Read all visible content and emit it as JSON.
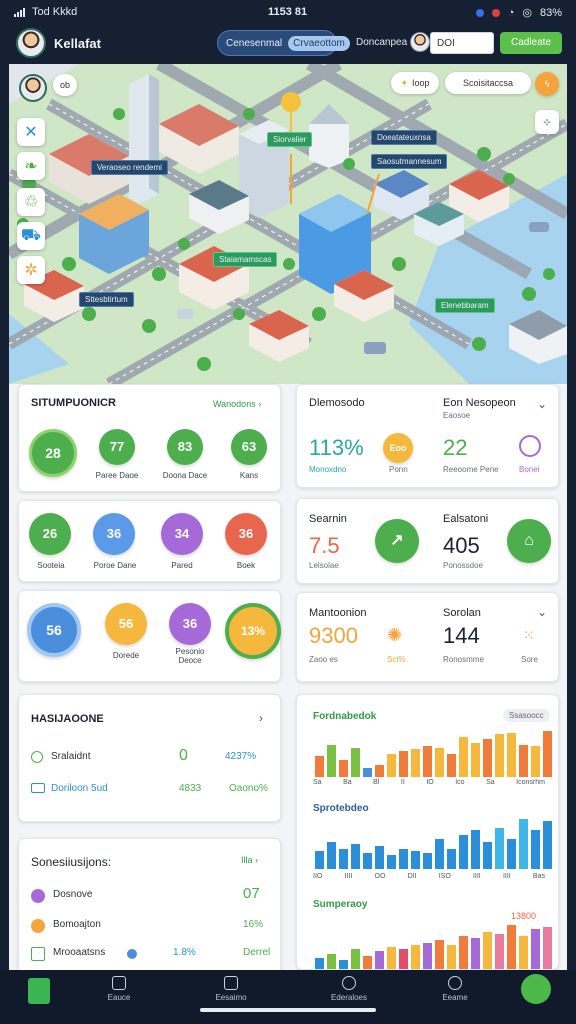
{
  "status_bar": {
    "carrier": "Tod Kkkd ",
    "time": "1153 81",
    "battery": "83%"
  },
  "header": {
    "title": "Kellafat",
    "segment": {
      "left": "Cenesenmal",
      "right": "Crvaeottom"
    },
    "profile_label": "Doncanpea",
    "search_value": "DOI",
    "action_label": "Cadleate"
  },
  "map": {
    "pill_left": "ob",
    "pill_mid": "Ioop",
    "pill_right": "Scoisitaccsa",
    "labels": {
      "label1": "Veraoseo rendemi",
      "label2": "Siorvalier",
      "label3": "Doeatateuxnsa",
      "label4": "Saosutmannesum",
      "label5": "Staiamamscas",
      "label6": "Sttesbtirtum",
      "label7": "Elenebbaram"
    }
  },
  "card1": {
    "title": "SITUMPUONICR",
    "link": "Wanodons",
    "items": [
      {
        "value": "28",
        "label": ""
      },
      {
        "value": "77",
        "label": "Paree Daoe"
      },
      {
        "value": "83",
        "label": "Doona Dace"
      },
      {
        "value": "63",
        "label": "Kans"
      }
    ]
  },
  "card2": {
    "items": [
      {
        "value": "26",
        "label": "Sooteia"
      },
      {
        "value": "36",
        "label": "Poroe Dane"
      },
      {
        "value": "34",
        "label": "Pared"
      },
      {
        "value": "36",
        "label": "Boek"
      }
    ]
  },
  "card3": {
    "items": [
      {
        "value": "56",
        "label": ""
      },
      {
        "value": "56",
        "label": "Dorede"
      },
      {
        "value": "36",
        "label": "Pesonio Deoce"
      },
      {
        "value": "13%",
        "label": ""
      }
    ]
  },
  "card4": {
    "title": "HASIJAOONE",
    "rows": [
      {
        "label": "Sralaidnt",
        "value": "0",
        "pct": "4237%"
      },
      {
        "label": "Doriloon 5ud",
        "value": "4833",
        "pct": "Oaono%"
      }
    ]
  },
  "card5": {
    "title": "Sonesiiusijons:",
    "link": "Illa",
    "rows": [
      {
        "label": "Dosnove",
        "value": "07"
      },
      {
        "label": "Bomoajton",
        "value": "16%"
      },
      {
        "label": "Mrooaatsns",
        "value": "1.8%",
        "extra": "Derrel"
      }
    ]
  },
  "kpi1": {
    "left_title": "Dlemosodo",
    "left_value": "113%",
    "left_sub": "Monoxdno",
    "right_title": "Eon Nesopeon",
    "right_sub": "Eaosoe",
    "right_value": "22",
    "right_value_sub": "Reeoome Pene",
    "mid_circle": "Eoo",
    "mid_sub": "Ponn",
    "icon_sub": "Bonei"
  },
  "kpi2": {
    "left_title": "Searnin",
    "left_value": "7.5",
    "left_sub": "Lelsolae",
    "right_title": "Ealsatoni",
    "right_value": "405",
    "right_sub": "Ponossdoe"
  },
  "kpi3": {
    "left_title": "Mantoonion",
    "left_value": "9300",
    "left_sub": "Zaoo es",
    "mid_sub": "Sct%",
    "right_title": "Sorolan",
    "right_value": "144",
    "right_sub": "Ronosmme",
    "icon_sub": "Sore"
  },
  "chart_panel": {
    "chart1_title": "Fordnabedok",
    "chart1_badge": "Ssasoocc",
    "chart2_title": "Sprotebdeo",
    "chart3_title": "Sumperaoy",
    "chart3_value": "13800",
    "axis1": [
      "Sa",
      "Ba",
      "Bl",
      "II",
      "IO",
      "Ico",
      "Sa",
      "Iconsrhm"
    ],
    "axis2": [
      "IIO",
      "IIII",
      "OO",
      "DII",
      "ISO",
      "IIII",
      "IIII",
      "Bas"
    ]
  },
  "chart_data": [
    {
      "type": "bar",
      "title": "Fordnabedok",
      "values": [
        28,
        42,
        22,
        38,
        12,
        16,
        30,
        34,
        36,
        40,
        38,
        30,
        52,
        44,
        50,
        56,
        58,
        42,
        40,
        60
      ],
      "colors": [
        "#f07b3a",
        "#7cc043",
        "#f07b3a",
        "#7cc043",
        "#4a8fdd",
        "#f07b3a",
        "#f5b83c",
        "#f07b3a",
        "#f5b83c",
        "#f07b3a",
        "#f5b83c",
        "#f07b3a",
        "#f5b83c",
        "#f5b83c",
        "#f07b3a",
        "#f5b83c",
        "#f5b83c",
        "#f07b3a",
        "#f5b83c",
        "#f07b3a"
      ]
    },
    {
      "type": "bar",
      "title": "Sprotebdeo",
      "values": [
        16,
        24,
        18,
        22,
        14,
        20,
        12,
        18,
        16,
        14,
        26,
        18,
        30,
        34,
        24,
        36,
        26,
        44,
        34,
        42
      ],
      "colors": [
        "#2a8fd8",
        "#2a8fd8",
        "#2a8fd8",
        "#2a8fd8",
        "#2a8fd8",
        "#2a8fd8",
        "#2a8fd8",
        "#2a8fd8",
        "#2a8fd8",
        "#2a8fd8",
        "#2a8fd8",
        "#2a8fd8",
        "#2a8fd8",
        "#2a8fd8",
        "#2a8fd8",
        "#3fb6e8",
        "#2a8fd8",
        "#3fb6e8",
        "#2a8fd8",
        "#2a8fd8"
      ]
    },
    {
      "type": "bar",
      "title": "Sumperaoy",
      "values": [
        10,
        14,
        8,
        18,
        12,
        16,
        20,
        18,
        22,
        24,
        26,
        22,
        30,
        28,
        34,
        32,
        40,
        30,
        36,
        38
      ],
      "colors": [
        "#2a8fd8",
        "#7cc043",
        "#2a8fd8",
        "#7cc043",
        "#f07b3a",
        "#a66ad8",
        "#f5b83c",
        "#e04f6a",
        "#f5b83c",
        "#a66ad8",
        "#f07b3a",
        "#f5b83c",
        "#f07b3a",
        "#a66ad8",
        "#f5b83c",
        "#e87aa0",
        "#f07b3a",
        "#f5b83c",
        "#a66ad8",
        "#e87aa0"
      ]
    }
  ],
  "tabs": [
    {
      "label": "Eauce"
    },
    {
      "label": "Eesaimo"
    },
    {
      "label": "Ederaloes"
    },
    {
      "label": "Eeame"
    }
  ]
}
